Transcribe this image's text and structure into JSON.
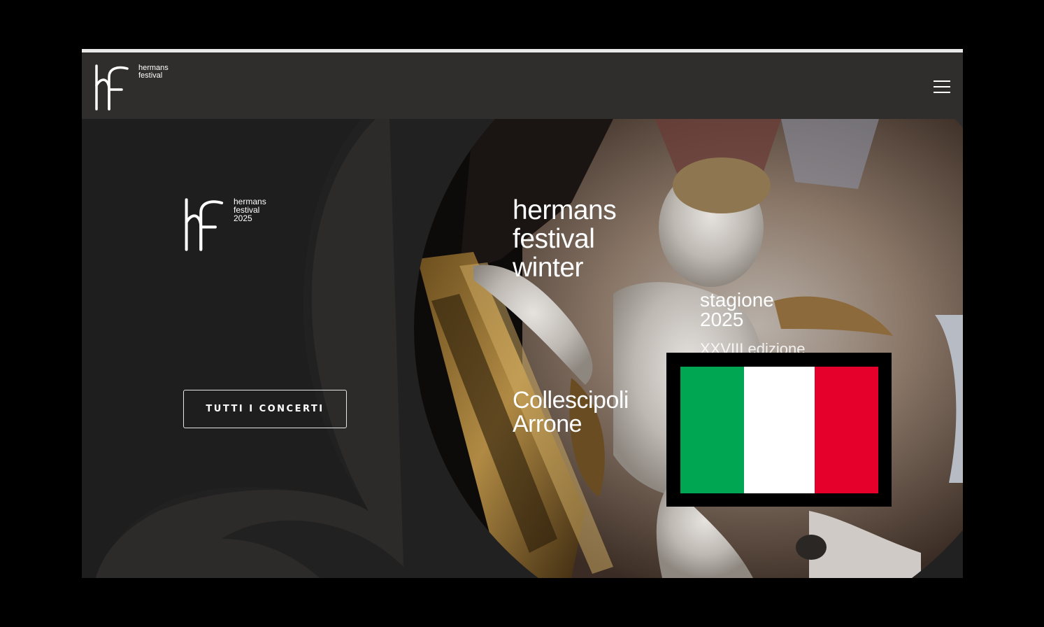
{
  "header": {
    "brand_lines": "hermans\nfestival",
    "menu_icon": "hamburger-menu-icon"
  },
  "hero": {
    "logo_lines": "hermans\nfestival\n2025",
    "cta_label": "TUTTI I CONCERTI",
    "title_lines": "hermans\nfestival\nwinter",
    "season_lines": "stagione\n2025",
    "edition_partial": "XXVIII edizione",
    "towns_lines": "Collescipoli\nArrone"
  },
  "language_flag": {
    "icon": "italian-flag-icon",
    "colors": [
      "#00a651",
      "#ffffff",
      "#e4002b"
    ]
  },
  "colors": {
    "page_background": "#000000",
    "header_background": "#2f2e2d",
    "hero_background": "#222121",
    "text": "#ffffff"
  }
}
